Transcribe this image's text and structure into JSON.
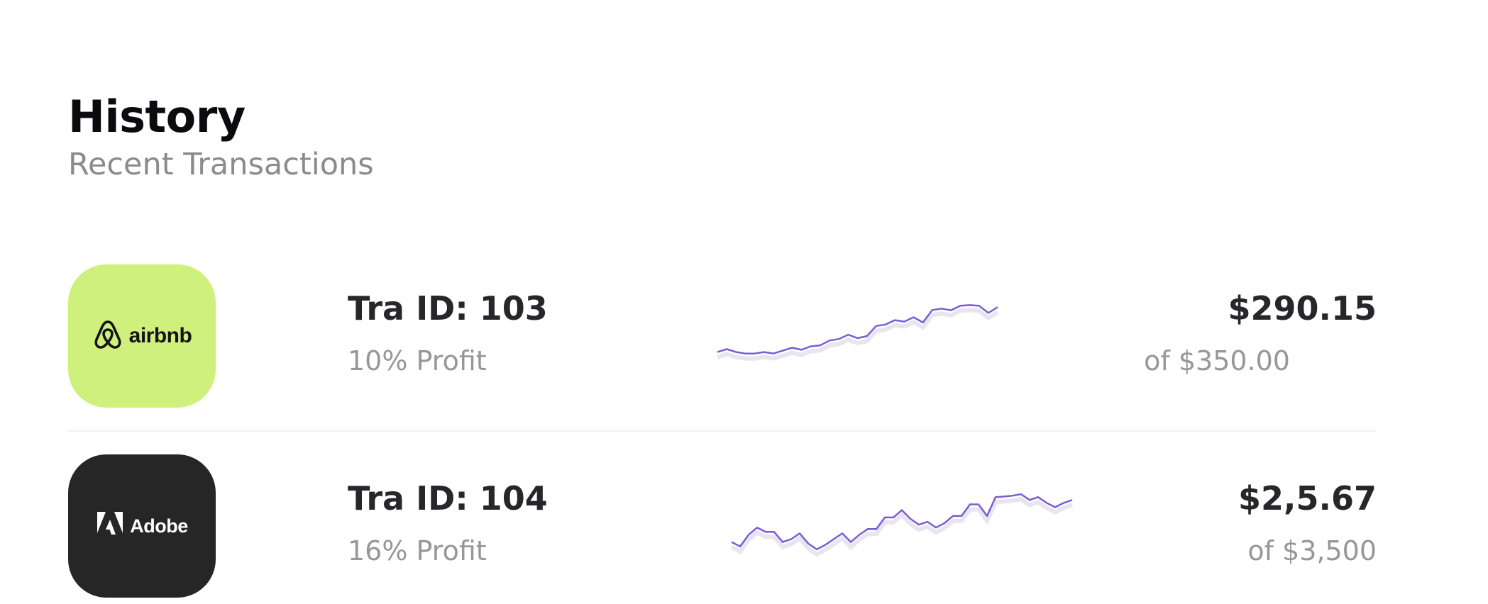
{
  "header": {
    "title": "History",
    "subtitle": "Recent Transactions"
  },
  "transactions": [
    {
      "logo_text": "airbnb",
      "logo_icon": "airbnb-logo-icon",
      "logo_color": "#d0f07e",
      "id_label": "Tra ID: 103",
      "profit_label": "10% Profit",
      "amount": "$290.15",
      "of_total": "of $350.00",
      "trend": [
        10,
        11,
        10,
        9.5,
        9.5,
        10,
        9.5,
        10.5,
        11.5,
        10.8,
        12,
        12.3,
        14,
        14.5,
        16,
        14.8,
        15.5,
        19,
        19.5,
        21,
        20.5,
        22,
        20.2,
        24.5,
        25,
        24.4,
        26,
        26.2,
        26,
        23.5,
        25.5
      ]
    },
    {
      "logo_text": "Adobe",
      "logo_icon": "adobe-logo-icon",
      "logo_color": "#262626",
      "id_label": "Tra ID: 104",
      "profit_label": "16% Profit",
      "amount": "$2,5.67",
      "of_total": "of $3,500",
      "trend": [
        10,
        8.5,
        12.5,
        15,
        13.5,
        13.5,
        10,
        11,
        13,
        9.5,
        7.5,
        9,
        11,
        13,
        10,
        12.5,
        14.5,
        14.5,
        18.5,
        18.5,
        21,
        18,
        16,
        17,
        15,
        16.5,
        19,
        19,
        23,
        23,
        19,
        25.5,
        25.7,
        26,
        26.5,
        24.5,
        25.5,
        23.5,
        22,
        23.5,
        24.5
      ]
    }
  ],
  "colors": {
    "trend_line": "#7a5cd4",
    "title": "#0b0b0f",
    "muted": "#8a8a8f"
  }
}
